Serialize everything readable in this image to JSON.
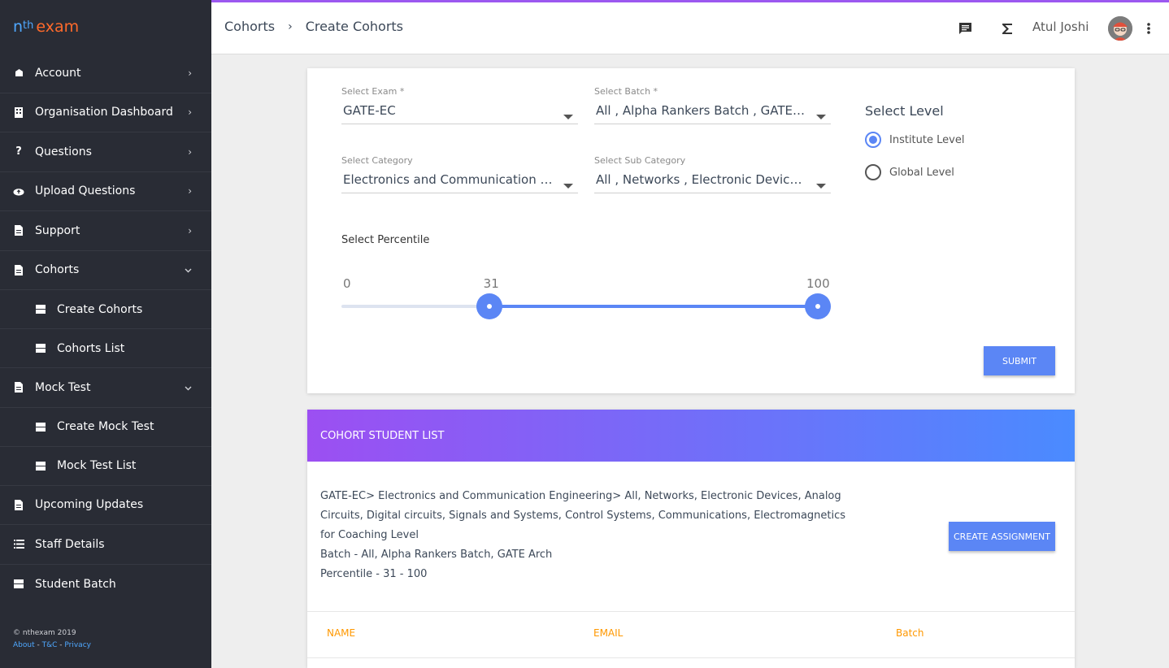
{
  "brand": {
    "logo_n": "n",
    "logo_th": "th",
    "logo_exam": "exam"
  },
  "sidebar": {
    "items": [
      {
        "label": "Account",
        "icon": "account-icon",
        "chev": "›"
      },
      {
        "label": "Organisation Dashboard",
        "icon": "building-icon",
        "chev": "›"
      },
      {
        "label": "Questions",
        "icon": "question-icon",
        "chev": "›"
      },
      {
        "label": "Upload Questions",
        "icon": "cloud-upload-icon",
        "chev": "›"
      },
      {
        "label": "Support",
        "icon": "document-icon",
        "chev": "›"
      },
      {
        "label": "Cohorts",
        "icon": "document-icon",
        "chev": "⌄"
      },
      {
        "label": "Create Cohorts",
        "icon": "table-icon"
      },
      {
        "label": "Cohorts List",
        "icon": "table-icon"
      },
      {
        "label": "Mock Test",
        "icon": "document-icon",
        "chev": "⌄"
      },
      {
        "label": "Create Mock Test",
        "icon": "table-icon"
      },
      {
        "label": "Mock Test List",
        "icon": "table-icon"
      },
      {
        "label": "Upcoming Updates",
        "icon": "document-icon"
      },
      {
        "label": "Staff Details",
        "icon": "list-icon"
      },
      {
        "label": "Student Batch",
        "icon": "table-icon"
      }
    ],
    "footer": {
      "copyright": "© nthexam 2019",
      "about": "About",
      "sep1": " - ",
      "tc": "T&C",
      "sep2": " - ",
      "privacy": "Privacy"
    }
  },
  "header": {
    "crumb1": "Cohorts",
    "crumb_sep": "›",
    "crumb2": "Create Cohorts",
    "user_name": "Atul Joshi"
  },
  "form": {
    "exam": {
      "label": "Select Exam *",
      "value": "GATE-EC"
    },
    "batch": {
      "label": "Select Batch *",
      "value": "All , Alpha Rankers Batch , GATE Arch"
    },
    "category": {
      "label": "Select Category",
      "value": "Electronics and Communication Engineering"
    },
    "subcategory": {
      "label": "Select Sub Category",
      "value": "All , Networks , Electronic Devices , Analog Circuits"
    },
    "level_title": "Select Level",
    "levels": [
      {
        "label": "Institute Level",
        "selected": true
      },
      {
        "label": "Global Level",
        "selected": false
      }
    ],
    "percentile_title": "Select Percentile",
    "percentile": {
      "min": 0,
      "max": 100,
      "low": 31,
      "high": 100,
      "min_label": "0",
      "low_label": "31",
      "high_label": "100"
    },
    "submit": "SUBMIT"
  },
  "cohort_list": {
    "title": "COHORT STUDENT LIST",
    "line1": "GATE-EC> Electronics and Communication Engineering> All, Networks, Electronic Devices, Analog Circuits, Digital circuits, Signals and Systems, Control Systems, Communications, Electromagnetics for Coaching Level",
    "line2": "Batch - All, Alpha Rankers Batch, GATE Arch",
    "line3": "Percentile - 31 - 100",
    "create_assignment": "CREATE ASSIGNMENT",
    "columns": [
      "NAME",
      "EMAIL",
      "Batch"
    ]
  },
  "colors": {
    "accent": "#5b86f5",
    "sidebar": "#292c35",
    "header_orange": "#ff9800"
  }
}
